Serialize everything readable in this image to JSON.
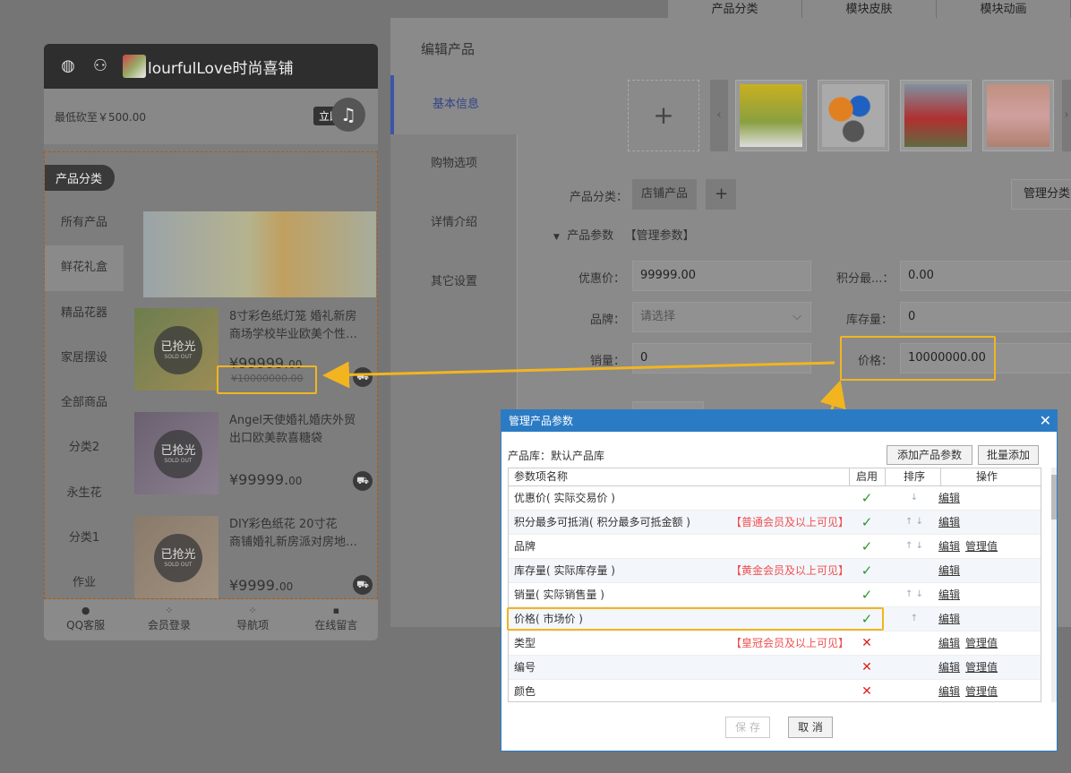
{
  "bg_tabs": [
    "产品分类",
    "模块皮肤",
    "模块动画"
  ],
  "phone": {
    "title": "lourfulLove时尚喜铺",
    "notice": "最低砍至￥500.00",
    "notice_btn": "立即",
    "category_tag": "产品分类",
    "categories": [
      "所有产品",
      "鲜花礼盒",
      "精品花器",
      "家居摆设",
      "全部商品",
      "分类2",
      "永生花",
      "分类1",
      "作业"
    ],
    "products": [
      {
        "name": "8寸彩色纸灯笼 婚礼新房\n商场学校毕业欧美个性…",
        "price": "¥99999.",
        "price_dec": "00",
        "old": "¥10000000.00",
        "sold": "已抢光",
        "sold_en": "SOLD OUT"
      },
      {
        "name": "Angel天使婚礼婚庆外贸\n出口欧美款喜糖袋",
        "price": "¥99999.",
        "price_dec": "00",
        "old": "",
        "sold": "已抢光",
        "sold_en": "SOLD OUT"
      },
      {
        "name": "DIY彩色纸花 20寸花\n商铺婚礼新房派对房地…",
        "price": "¥9999.",
        "price_dec": "00",
        "old": "",
        "sold": "已抢光",
        "sold_en": "SOLD OUT"
      }
    ],
    "footer": [
      "QQ客服",
      "会员登录",
      "导航项",
      "在线留言"
    ]
  },
  "editor": {
    "title": "编辑产品",
    "tabs": [
      "基本信息",
      "购物选项",
      "详情介绍",
      "其它设置"
    ],
    "category_label": "产品分类：",
    "category_value": "店铺产品",
    "manage_category": "管理分类",
    "params_label": "产品参数",
    "params_manage": "【管理参数】",
    "fields": {
      "discount_label": "优惠价：",
      "discount_value": "99999.00",
      "points_label": "积分最...：",
      "points_value": "0.00",
      "brand_label": "品牌：",
      "brand_placeholder": "请选择",
      "stock_label": "库存量：",
      "stock_value": "0",
      "sales_label": "销量：",
      "sales_value": "0",
      "price_label": "价格：",
      "price_value": "10000000.00"
    }
  },
  "dialog": {
    "title": "管理产品参数",
    "library": "产品库：默认产品库",
    "add_btn": "添加产品参数",
    "batch_btn": "批量添加",
    "headers": [
      "参数项名称",
      "启用",
      "排序",
      "操作"
    ],
    "rows": [
      {
        "name": "优惠价( 实际交易价 )",
        "note": "",
        "enabled": true,
        "sort": "↓",
        "ops": [
          "编辑"
        ]
      },
      {
        "name": "积分最多可抵消( 积分最多可抵金额 )",
        "note": "【普通会员及以上可见】",
        "enabled": true,
        "sort": "↑ ↓",
        "ops": [
          "编辑"
        ]
      },
      {
        "name": "品牌",
        "note": "",
        "enabled": true,
        "sort": "↑ ↓",
        "ops": [
          "编辑",
          "管理值"
        ]
      },
      {
        "name": "库存量( 实际库存量 )",
        "note": "【黄金会员及以上可见】",
        "enabled": true,
        "sort": "",
        "ops": [
          "编辑"
        ]
      },
      {
        "name": "销量( 实际销售量 )",
        "note": "",
        "enabled": true,
        "sort": "↑ ↓",
        "ops": [
          "编辑"
        ]
      },
      {
        "name": "价格( 市场价 )",
        "note": "",
        "enabled": true,
        "sort": "↑",
        "ops": [
          "编辑"
        ]
      },
      {
        "name": "类型",
        "note": "【皇冠会员及以上可见】",
        "enabled": false,
        "sort": "",
        "ops": [
          "编辑",
          "管理值"
        ]
      },
      {
        "name": "编号",
        "note": "",
        "enabled": false,
        "sort": "",
        "ops": [
          "编辑",
          "管理值"
        ]
      },
      {
        "name": "颜色",
        "note": "",
        "enabled": false,
        "sort": "",
        "ops": [
          "编辑",
          "管理值"
        ]
      }
    ],
    "save": "保 存",
    "cancel": "取 消"
  },
  "colors": {
    "highlight": "#f2b51f",
    "dialog_blue": "#2b7bc4"
  }
}
